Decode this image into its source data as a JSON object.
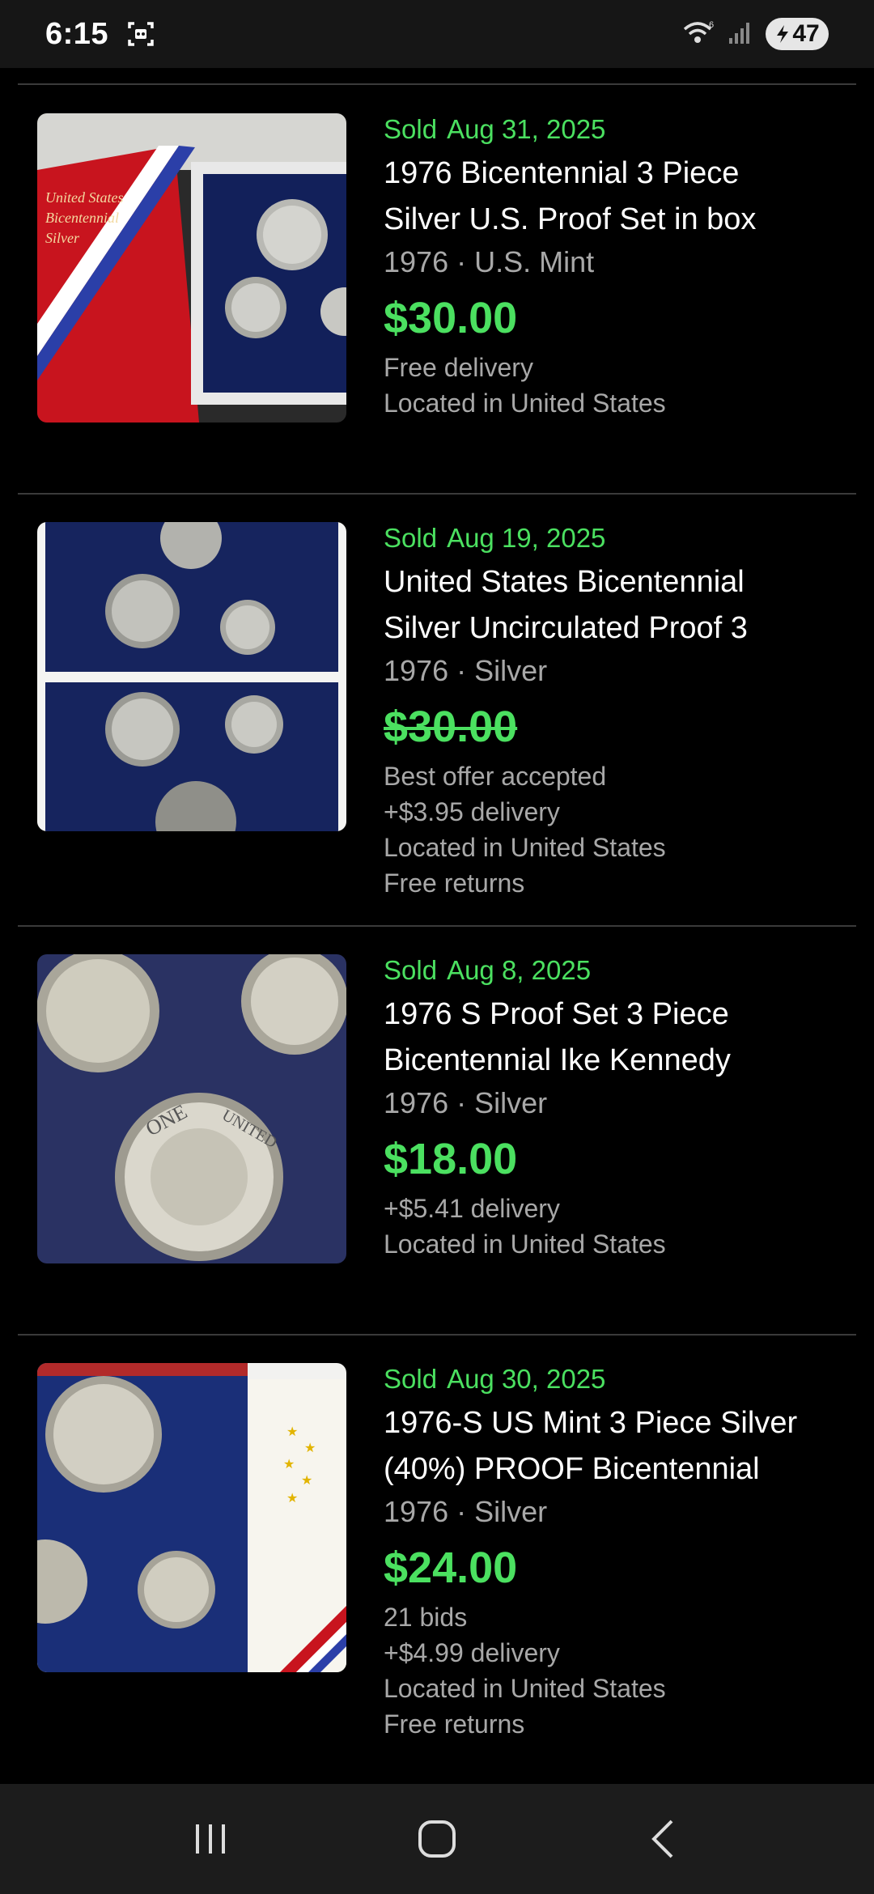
{
  "status": {
    "time": "6:15",
    "battery": "47",
    "icons": [
      "screen-record-icon",
      "wifi-icon",
      "signal-icon",
      "battery-icon"
    ]
  },
  "listings": [
    {
      "sold_label": "Sold",
      "date": "Aug 31, 2025",
      "title_line1": "1976 Bicentennial 3 Piece",
      "title_line2": "Silver U.S. Proof Set in box",
      "subtitle": "1976 · U.S. Mint",
      "price": "$30.00",
      "details": [
        "Free delivery",
        "Located in United States"
      ]
    },
    {
      "sold_label": "Sold",
      "date": "Aug 19, 2025",
      "title_line1": "United States Bicentennial",
      "title_line2": "Silver Uncirculated Proof 3",
      "subtitle": "1976 · Silver",
      "price": "$30.00",
      "details": [
        "Best offer accepted",
        "+$3.95 delivery",
        "Located in United States",
        "Free returns"
      ]
    },
    {
      "sold_label": "Sold",
      "date": "Aug 8, 2025",
      "title_line1": "1976 S Proof Set 3 Piece",
      "title_line2": "Bicentennial Ike Kennedy",
      "subtitle": "1976 · Silver",
      "price": "$18.00",
      "details": [
        "+$5.41 delivery",
        "Located in United States"
      ]
    },
    {
      "sold_label": "Sold",
      "date": "Aug 30, 2025",
      "title_line1": "1976-S US Mint 3 Piece Silver",
      "title_line2": "(40%) PROOF Bicentennial",
      "subtitle": "1976 · Silver",
      "price": "$24.00",
      "details": [
        "21 bids",
        "+$4.99 delivery",
        "Located in United States",
        "Free returns"
      ]
    }
  ],
  "colors": {
    "accent_green": "#4be060",
    "muted_text": "#a8a8a8",
    "background": "#000000"
  },
  "nav": {
    "icons": [
      "recent-apps-icon",
      "home-icon",
      "back-icon"
    ]
  }
}
